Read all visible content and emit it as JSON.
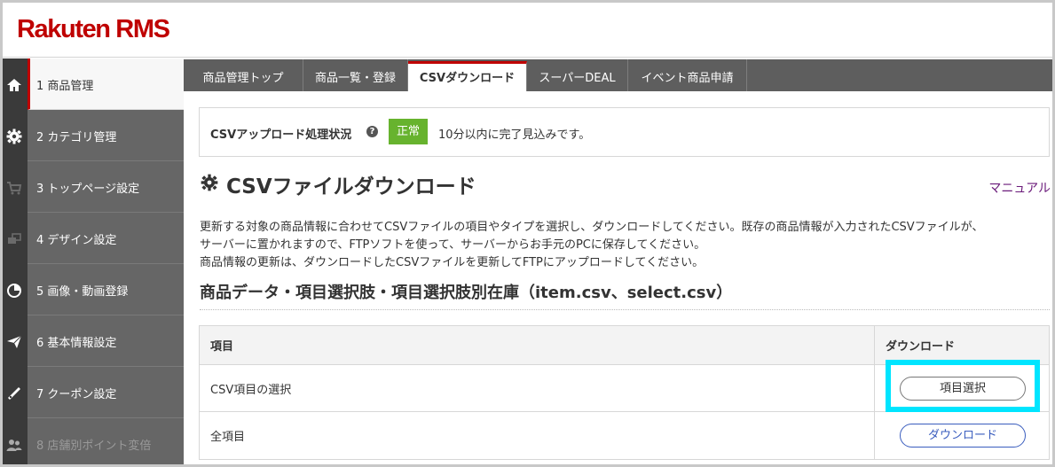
{
  "header": {
    "logo": "Rakuten RMS"
  },
  "sidebar": {
    "items": [
      {
        "label": "1 商品管理",
        "icon": "home-icon"
      },
      {
        "label": "2 カテゴリ管理",
        "icon": "gear-icon"
      },
      {
        "label": "3 トップページ設定",
        "icon": "cart-icon"
      },
      {
        "label": "4 デザイン設定",
        "icon": "design-icon"
      },
      {
        "label": "5 画像・動画登録",
        "icon": "pie-icon"
      },
      {
        "label": "6 基本情報設定",
        "icon": "send-icon"
      },
      {
        "label": "7 クーポン設定",
        "icon": "coupon-icon"
      },
      {
        "label": "8 店舗別ポイント変倍",
        "icon": "users-icon"
      }
    ]
  },
  "tabs": [
    {
      "label": "商品管理トップ"
    },
    {
      "label": "商品一覧・登録"
    },
    {
      "label": "CSVダウンロード"
    },
    {
      "label": "スーパーDEAL"
    },
    {
      "label": "イベント商品申請"
    }
  ],
  "status": {
    "label": "CSVアップロード処理状況",
    "help": "?",
    "badge": "正常",
    "message": "10分以内に完了見込みです。"
  },
  "page": {
    "title": "CSVファイルダウンロード",
    "manual": "マニュアル",
    "desc1": "更新する対象の商品情報に合わせてCSVファイルの項目やタイプを選択し、ダウンロードしてください。既存の商品情報が入力されたCSVファイルが、",
    "desc2": "サーバーに置かれますので、FTPソフトを使って、サーバーからお手元のPCに保存してください。",
    "desc3": "商品情報の更新は、ダウンロードしたCSVファイルを更新してFTPにアップロードしてください。",
    "section_title": "商品データ・項目選択肢・項目選択肢別在庫（item.csv、select.csv）"
  },
  "table": {
    "col_item": "項目",
    "col_download": "ダウンロード",
    "rows": [
      {
        "item": "CSV項目の選択",
        "button": "項目選択"
      },
      {
        "item": "全項目",
        "button": "ダウンロード"
      }
    ]
  },
  "colors": {
    "brand": "#bf0000",
    "badge_ok": "#67b32e",
    "highlight": "#00e5ff",
    "link": "#3a5dbe"
  }
}
